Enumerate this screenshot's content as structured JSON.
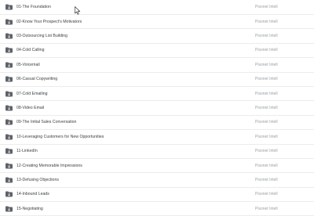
{
  "folders": [
    {
      "name": "01-The Foundation",
      "owner": "Pisonet Intell"
    },
    {
      "name": "02-Know Your Prospect's Motivators",
      "owner": "Pisonet Intell"
    },
    {
      "name": "03-Outsourcing List Building",
      "owner": "Pisonet Intell"
    },
    {
      "name": "04-Cold Calling",
      "owner": "Pisonet Intell"
    },
    {
      "name": "05-Voicemail",
      "owner": "Pisonet Intell"
    },
    {
      "name": "06-Casual Copywriting",
      "owner": "Pisonet Intell"
    },
    {
      "name": "07-Cold Emailing",
      "owner": "Pisonet Intell"
    },
    {
      "name": "08-Video Email",
      "owner": "Pisonet Intell"
    },
    {
      "name": "09-The Initial Sales Conversation",
      "owner": "Pisonet Intell"
    },
    {
      "name": "10-Leveraging Customers for New Opportunities",
      "owner": "Pisonet Intell"
    },
    {
      "name": "11-LinkedIn",
      "owner": "Pisonet Intell"
    },
    {
      "name": "12-Creating Memorable Impressions",
      "owner": "Pisonet Intell"
    },
    {
      "name": "13-Defusing Objections",
      "owner": "Pisonet Intell"
    },
    {
      "name": "14-Inbound Leads",
      "owner": "Pisonet Intell"
    },
    {
      "name": "15-Negotiating",
      "owner": "Pisonet Intell"
    }
  ],
  "icon": "shared-folder-icon",
  "colors": {
    "folder": "#5f6368",
    "owner_text": "#9aa0a6",
    "name_text": "#3c4043"
  }
}
